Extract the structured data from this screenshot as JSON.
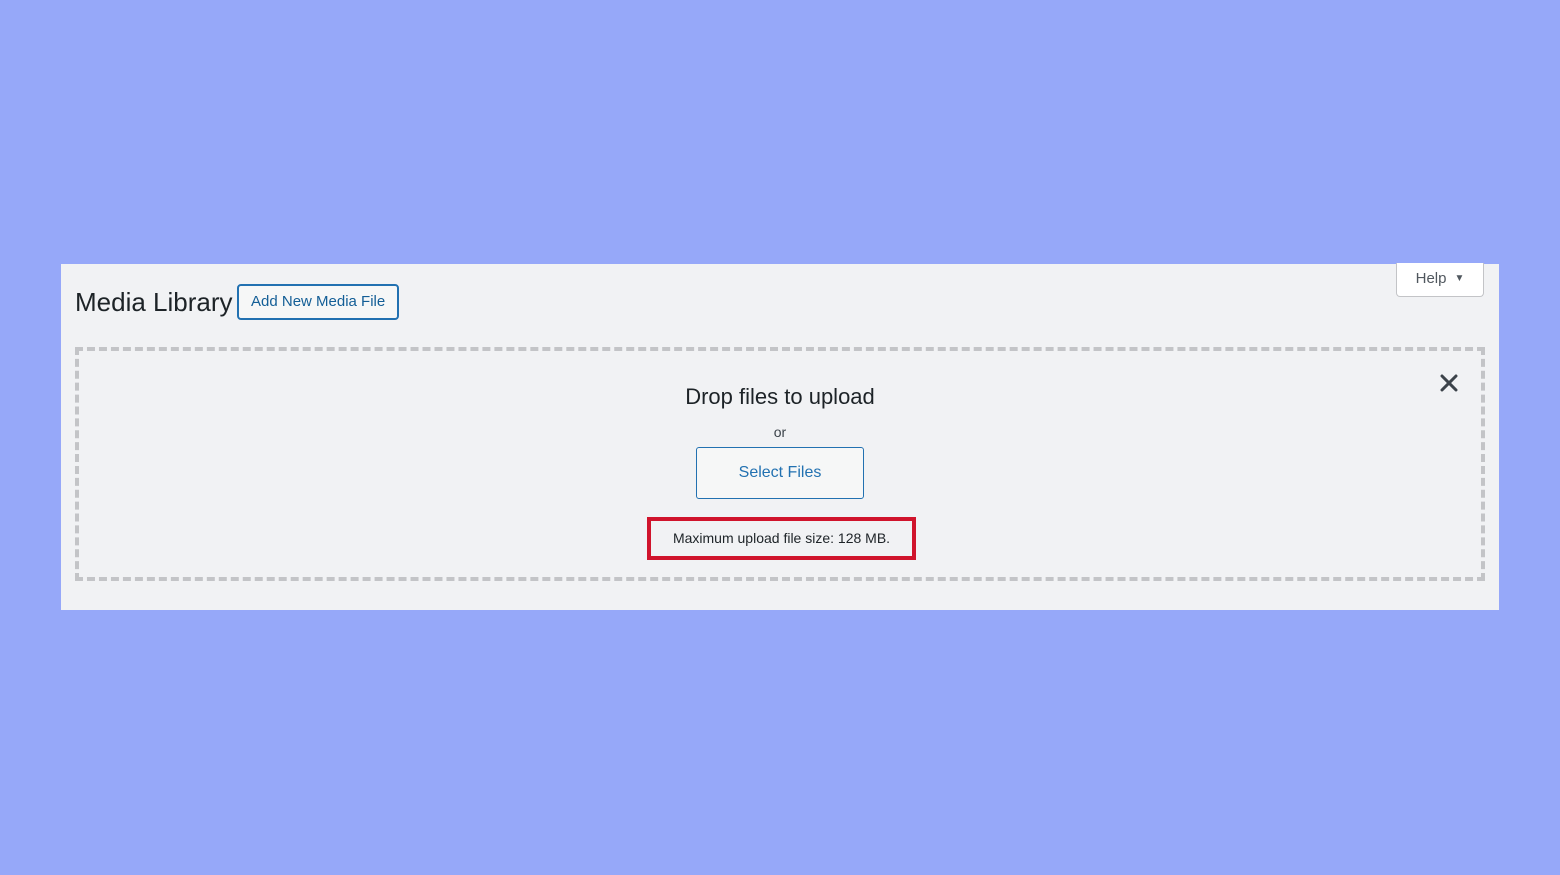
{
  "header": {
    "title": "Media Library",
    "add_new_label": "Add New Media File",
    "help_label": "Help"
  },
  "uploader": {
    "drop_title": "Drop files to upload",
    "or_text": "or",
    "select_files_label": "Select Files",
    "max_upload_text": "Maximum upload file size: 128 MB."
  },
  "icons": {
    "close": "close-icon",
    "help_caret": "caret-down-icon"
  },
  "colors": {
    "background": "#96a8f9",
    "panel": "#f1f2f4",
    "accent": "#2271b1",
    "highlight": "#d0142c"
  }
}
